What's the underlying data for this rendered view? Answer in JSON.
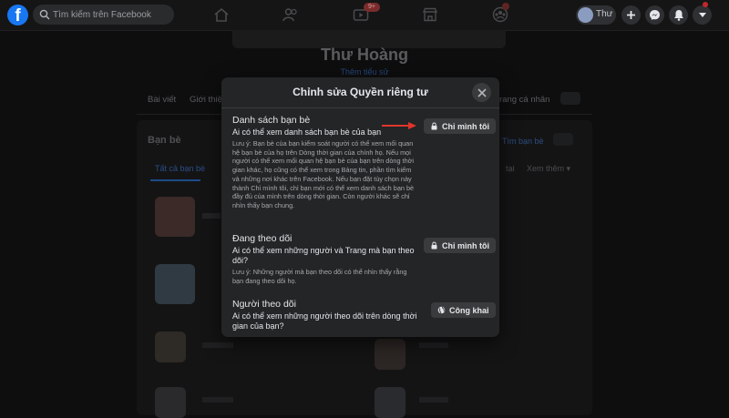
{
  "nav": {
    "search_placeholder": "Tìm kiếm trên Facebook",
    "video_badge": "9+",
    "profile_name": "Thư"
  },
  "background": {
    "profile_name": "Thư Hoàng",
    "profile_sub": "Thêm tiểu sử",
    "tabs": [
      "Bài viết",
      "Giới thiệ",
      "rang cá nhân"
    ],
    "section_title": "Bạn bè",
    "find_friends": "Tìm bạn bè",
    "tab_all": "Tất cả bạn bè",
    "tab_right": [
      "tại",
      "Xem thêm ▾"
    ]
  },
  "modal": {
    "title": "Chỉnh sửa Quyền riêng tư",
    "sections": [
      {
        "title": "Danh sách bạn bè",
        "question": "Ai có thể xem danh sách bạn bè của bạn",
        "note": "Lưu ý: Bạn bè của bạn kiểm soát người có thể xem mối quan hệ bạn bè của họ trên Dòng thời gian của chính họ. Nếu mọi người có thể xem mối quan hệ bạn bè của bạn trên dòng thời gian khác, họ cũng có thể xem trong Bảng tin, phần tìm kiếm và những nơi khác trên Facebook. Nếu bạn đặt tùy chọn này thành Chỉ mình tôi, chỉ bạn mới có thể xem danh sách bạn bè đầy đủ của mình trên dòng thời gian. Còn người khác sẽ chỉ nhìn thấy bạn chung.",
        "button": "Chỉ mình tôi",
        "icon": "lock-icon"
      },
      {
        "title": "Đang theo dõi",
        "question": "Ai có thể xem những người và Trang mà bạn theo dõi?",
        "note": "Lưu ý: Những người mà bạn theo dõi có thể nhìn thấy rằng bạn đang theo dõi họ.",
        "button": "Chỉ mình tôi",
        "icon": "lock-icon"
      },
      {
        "title": "Người theo dõi",
        "question": "Ai có thể xem những người theo dõi trên dòng thời gian của bạn?",
        "note": "",
        "button": "Công khai",
        "icon": "globe-icon"
      }
    ]
  },
  "colors": {
    "fb_blue": "#1877f2",
    "modal_bg": "#242526",
    "button_bg": "#3a3b3c",
    "arrow": "#e0352b"
  }
}
